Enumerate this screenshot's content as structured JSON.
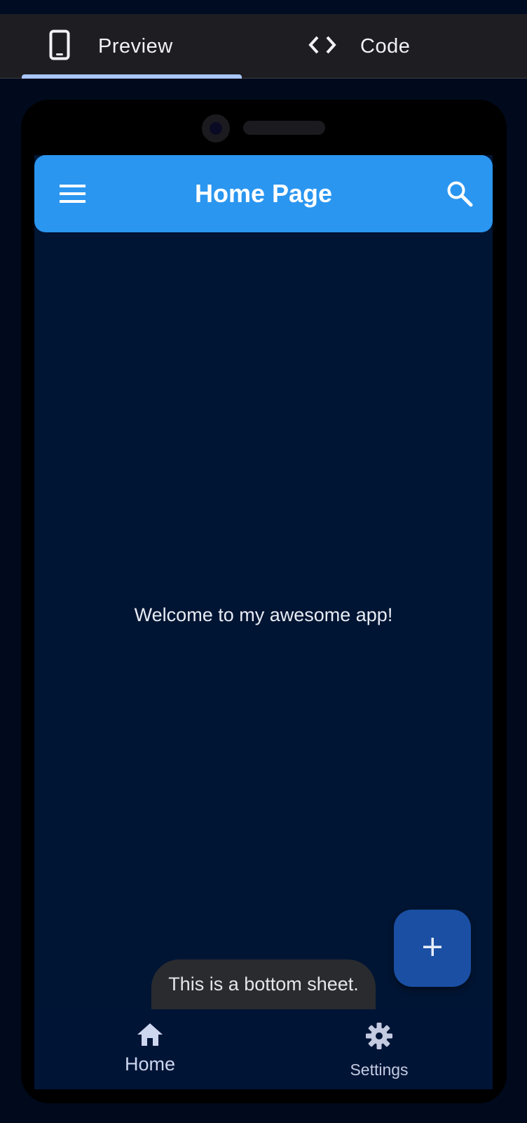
{
  "tabs": [
    {
      "label": "Preview",
      "icon": "phone-icon",
      "selected": true
    },
    {
      "label": "Code",
      "icon": "code-icon",
      "selected": false
    }
  ],
  "app": {
    "title": "Home Page",
    "menu_icon": "menu-icon",
    "search_icon": "search-icon",
    "body_text": "Welcome to my awesome app!",
    "bottom_sheet_text": "This is a bottom sheet.",
    "fab_icon": "plus-icon"
  },
  "bottom_nav": [
    {
      "label": "Home",
      "icon": "home-icon",
      "selected": true
    },
    {
      "label": "Settings",
      "icon": "gear-icon",
      "selected": false
    }
  ],
  "colors": {
    "appbar": "#2a96f0",
    "screen_bg": "#001533",
    "fab": "#1a4fa3",
    "tab_indicator": "#a9c7ff",
    "tab_bar": "#1e1e22"
  }
}
